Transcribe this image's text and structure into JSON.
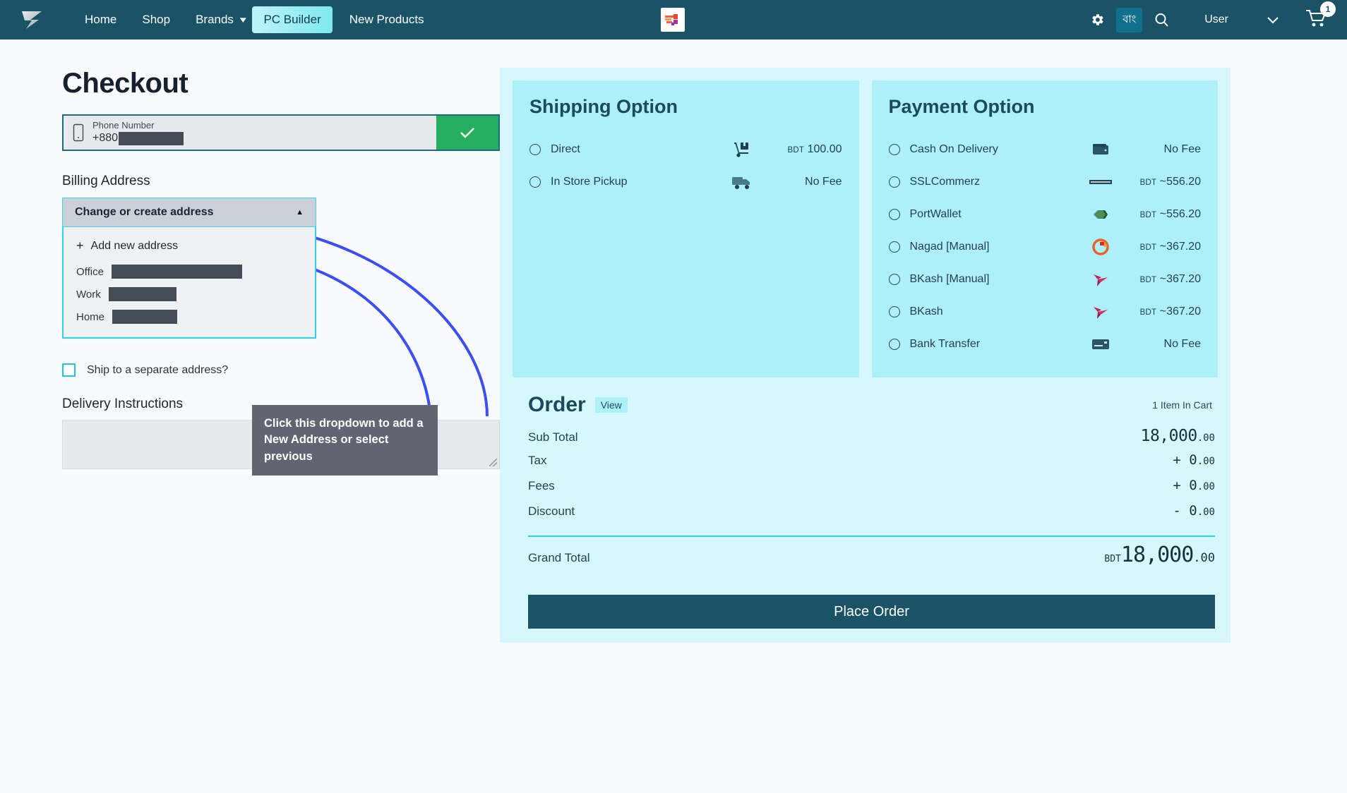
{
  "navbar": {
    "logo_icon": "brand-logo-icon",
    "links": [
      {
        "label": "Home",
        "active": false
      },
      {
        "label": "Shop",
        "active": false
      },
      {
        "label": "Brands",
        "active": false
      },
      {
        "label": "PC Builder",
        "active": true
      },
      {
        "label": "New Products",
        "active": false
      }
    ],
    "gear_icon": "gear-icon",
    "lang_label": "বাং",
    "search_icon": "search-icon",
    "user_label": "User",
    "user_chevron_icon": "chevron-down-icon",
    "cart_icon": "cart-icon",
    "cart_count": "1"
  },
  "checkout": {
    "title": "Checkout",
    "phone": {
      "icon": "mobile-phone-icon",
      "label": "Phone Number",
      "prefix": "+880",
      "value_redacted": true,
      "confirm_icon": "check-icon"
    },
    "billing_address_label": "Billing Address",
    "dropdown": {
      "header": "Change or create address",
      "caret_icon": "caret-up-icon",
      "add_new": "Add new address",
      "plus_icon": "plus-icon",
      "addresses": [
        {
          "label": "Office",
          "value_redacted": true
        },
        {
          "label": "Work",
          "value_redacted": true
        },
        {
          "label": "Home",
          "value_redacted": true
        }
      ]
    },
    "ship_separate_label": "Ship to a separate address?",
    "ship_separate_checked": false,
    "delivery_instructions_label": "Delivery Instructions",
    "delivery_instructions_value": "",
    "callout": "Click this dropdown to add a New Address or select previous"
  },
  "shipping": {
    "title": "Shipping Option",
    "options": [
      {
        "label": "Direct",
        "icon": "hand-truck-icon",
        "currency": "BDT",
        "price": "100.00",
        "selected": false
      },
      {
        "label": "In Store Pickup",
        "icon": "delivery-truck-icon",
        "currency": "",
        "price": "No Fee",
        "selected": false
      }
    ]
  },
  "payment": {
    "title": "Payment Option",
    "options": [
      {
        "label": "Cash On Delivery",
        "icon": "wallet-icon",
        "currency": "",
        "price": "No Fee",
        "selected": false
      },
      {
        "label": "SSLCommerz",
        "icon": "sslcommerz-logo-icon",
        "currency": "BDT",
        "price": "~556.20",
        "selected": false
      },
      {
        "label": "PortWallet",
        "icon": "portwallet-logo-icon",
        "currency": "BDT",
        "price": "~556.20",
        "selected": false
      },
      {
        "label": "Nagad [Manual]",
        "icon": "nagad-logo-icon",
        "currency": "BDT",
        "price": "~367.20",
        "selected": false
      },
      {
        "label": "BKash [Manual]",
        "icon": "bkash-logo-icon",
        "currency": "BDT",
        "price": "~367.20",
        "selected": false
      },
      {
        "label": "BKash",
        "icon": "bkash-logo-icon",
        "currency": "BDT",
        "price": "~367.20",
        "selected": false
      },
      {
        "label": "Bank Transfer",
        "icon": "bank-card-icon",
        "currency": "",
        "price": "No Fee",
        "selected": false
      }
    ]
  },
  "order": {
    "title": "Order",
    "view_label": "View",
    "items_in_cart": "1 Item In Cart",
    "rows": [
      {
        "label": "Sub Total",
        "amount": "18,000",
        "cents": ".00",
        "sign": "",
        "style": "big"
      },
      {
        "label": "Tax",
        "amount": "0",
        "cents": ".00",
        "sign": "+ ",
        "style": "mid"
      },
      {
        "label": "Fees",
        "amount": "0",
        "cents": ".00",
        "sign": "+ ",
        "style": "mid"
      },
      {
        "label": "Discount",
        "amount": "0",
        "cents": ".00",
        "sign": "- ",
        "style": "mid"
      }
    ],
    "grand_total_label": "Grand Total",
    "grand_total_currency": "BDT",
    "grand_total_amount": "18,000",
    "grand_total_cents": ".00",
    "place_order_label": "Place Order"
  },
  "colors": {
    "nav_bg": "#1b5366",
    "accent_cyan": "#2fd4ea",
    "panel_light": "#d6f8fd",
    "panel_mid": "#aef0fa",
    "success_green": "#27ae5f",
    "callout_bg": "#5f6672",
    "arrow_blue": "#3c4ff5"
  }
}
